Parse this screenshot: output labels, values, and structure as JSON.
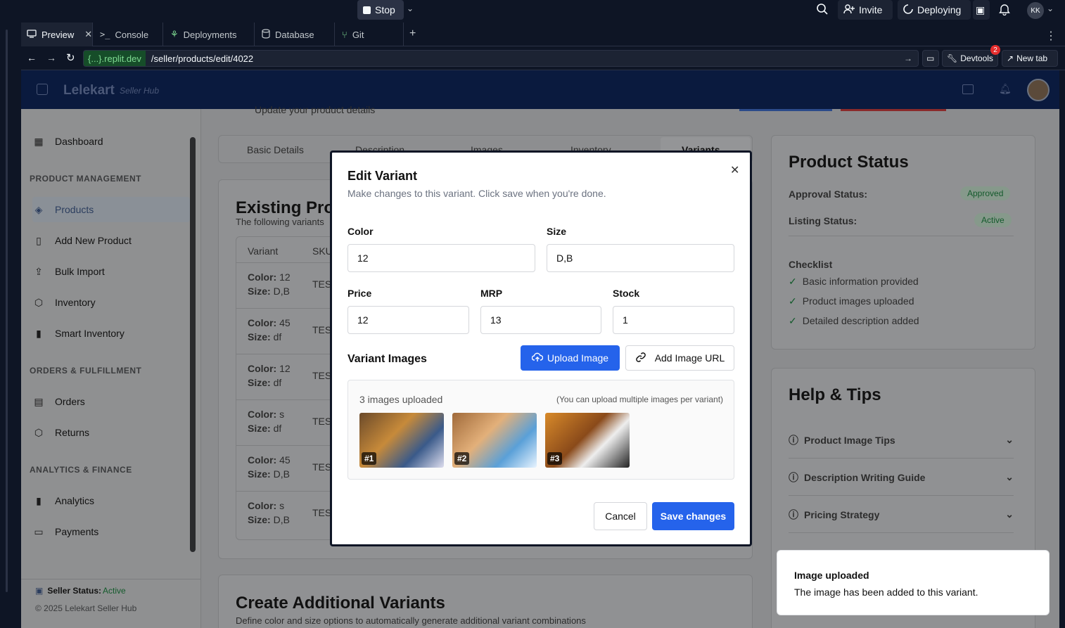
{
  "topbar": {
    "stop_label": "Stop",
    "invite_label": "Invite",
    "deploying_label": "Deploying",
    "avatar_initials": "KK"
  },
  "tabs": [
    {
      "label": "Preview"
    },
    {
      "label": "Console"
    },
    {
      "label": "Deployments"
    },
    {
      "label": "Database"
    },
    {
      "label": "Git"
    }
  ],
  "urlbar": {
    "host": "{...}.replit.dev",
    "path": "/seller/products/edit/4022",
    "devtools_label": "Devtools",
    "devtools_badge": "2",
    "new_tab_label": "New tab"
  },
  "app": {
    "brand": "Lelekart",
    "brand_sub": "Seller Hub"
  },
  "sidebar": {
    "items_top": [
      {
        "label": "Dashboard"
      }
    ],
    "section_product": "PRODUCT MANAGEMENT",
    "items_product": [
      {
        "label": "Products"
      },
      {
        "label": "Add New Product"
      },
      {
        "label": "Bulk Import"
      },
      {
        "label": "Inventory"
      },
      {
        "label": "Smart Inventory"
      }
    ],
    "section_orders": "ORDERS & FULFILLMENT",
    "items_orders": [
      {
        "label": "Orders"
      },
      {
        "label": "Returns"
      }
    ],
    "section_analytics": "ANALYTICS & FINANCE",
    "items_analytics": [
      {
        "label": "Analytics"
      },
      {
        "label": "Payments"
      }
    ],
    "seller_status_label": "Seller Status:",
    "seller_status_value": "Active",
    "copyright": "© 2025 Lelekart Seller Hub"
  },
  "main": {
    "subtitle": "Update your product details",
    "tabs": [
      "Basic Details",
      "Description",
      "Images",
      "Inventory",
      "Variants"
    ],
    "existing_title": "Existing Prod",
    "existing_sub": "The following variants",
    "table_headers": [
      "Variant",
      "SKU"
    ],
    "rows": [
      {
        "color": "12",
        "size": "D,B",
        "sku": "TES"
      },
      {
        "color": "45",
        "size": "df",
        "sku": "TES"
      },
      {
        "color": "12",
        "size": "df",
        "sku": "TES"
      },
      {
        "color": "s",
        "size": "df",
        "sku": "TES"
      },
      {
        "color": "45",
        "size": "D,B",
        "sku": "TES"
      },
      {
        "color": "s",
        "size": "D,B",
        "sku": "TES"
      }
    ],
    "color_key": "Color:",
    "size_key": "Size:",
    "create_title": "Create Additional Variants",
    "create_sub": "Define color and size options to automatically generate additional variant combinations"
  },
  "status_card": {
    "title": "Product Status",
    "approval_label": "Approval Status:",
    "approval_value": "Approved",
    "listing_label": "Listing Status:",
    "listing_value": "Active",
    "checklist_title": "Checklist",
    "checklist": [
      "Basic information provided",
      "Product images uploaded",
      "Detailed description added"
    ]
  },
  "help_card": {
    "title": "Help & Tips",
    "items": [
      "Product Image Tips",
      "Description Writing Guide",
      "Pricing Strategy"
    ]
  },
  "modal": {
    "title": "Edit Variant",
    "description": "Make changes to this variant. Click save when you're done.",
    "color_label": "Color",
    "color_value": "12",
    "size_label": "Size",
    "size_value": "D,B",
    "price_label": "Price",
    "price_value": "12",
    "mrp_label": "MRP",
    "mrp_value": "13",
    "stock_label": "Stock",
    "stock_value": "1",
    "images_title": "Variant Images",
    "upload_label": "Upload Image",
    "add_url_label": "Add Image URL",
    "images_count": "3 images uploaded",
    "images_hint": "(You can upload multiple images per variant)",
    "thumbs": [
      "#1",
      "#2",
      "#3"
    ],
    "cancel_label": "Cancel",
    "save_label": "Save changes"
  },
  "toast": {
    "title": "Image uploaded",
    "message": "The image has been added to this variant."
  },
  "colors": {
    "primary": "#2563eb",
    "success": "#16a34a",
    "ide_bg": "#0e1525"
  }
}
